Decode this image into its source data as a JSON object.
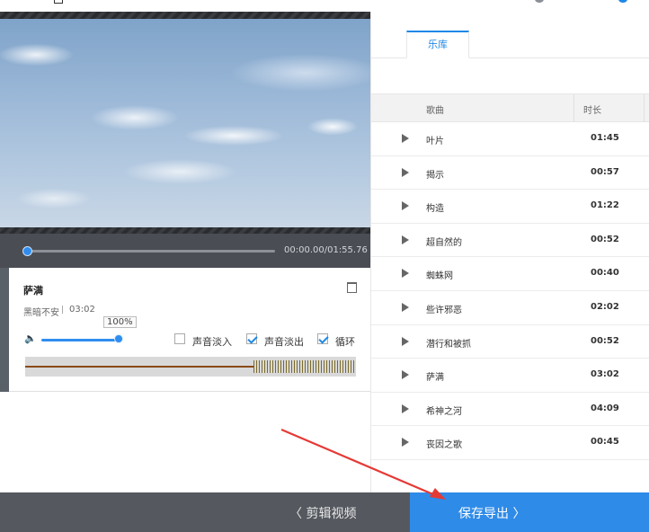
{
  "player": {
    "time": "00:00.00/01:55.76"
  },
  "track": {
    "name": "萨满",
    "artist": "黑暗不安",
    "duration": "03:02",
    "volume_label": "100%",
    "volume_value": 1.0,
    "options": [
      {
        "label": "声音淡入",
        "checked": false
      },
      {
        "label": "声音淡出",
        "checked": true
      },
      {
        "label": "循环",
        "checked": true
      }
    ]
  },
  "library": {
    "tab_label": "乐库",
    "columns": {
      "song": "歌曲",
      "duration": "时长"
    },
    "rows": [
      {
        "song": "叶片",
        "duration": "01:45"
      },
      {
        "song": "揭示",
        "duration": "00:57"
      },
      {
        "song": "构造",
        "duration": "01:22"
      },
      {
        "song": "超自然的",
        "duration": "00:52"
      },
      {
        "song": "蜘蛛网",
        "duration": "00:40"
      },
      {
        "song": "些许邪恶",
        "duration": "02:02"
      },
      {
        "song": "潜行和被抓",
        "duration": "00:52"
      },
      {
        "song": "萨满",
        "duration": "03:02"
      },
      {
        "song": "希神之河",
        "duration": "04:09"
      },
      {
        "song": "丧因之歌",
        "duration": "00:45"
      }
    ]
  },
  "footer": {
    "edit_video_label": "〈 剪辑视频",
    "save_export_label": "保存导出 〉"
  },
  "colors": {
    "accent": "#2f8be8",
    "footer_bg": "#55595f",
    "annotation_arrow": "#e53935"
  },
  "icons": [
    "play-icon",
    "trash-icon",
    "speaker-icon",
    "checkbox-icon"
  ]
}
